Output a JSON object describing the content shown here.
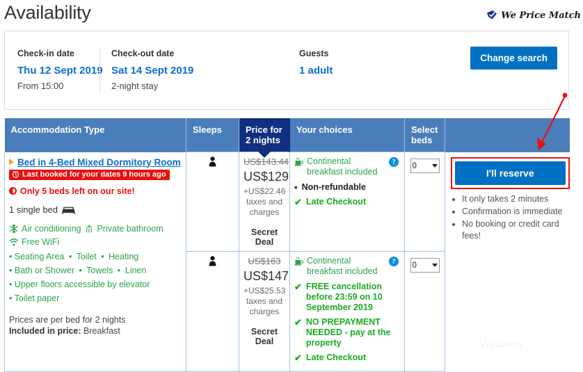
{
  "page": {
    "title": "Availability",
    "price_match": "We Price Match",
    "watermark": "Windows"
  },
  "search_summary": {
    "checkin": {
      "label": "Check-in date",
      "date": "Thu 12 Sept 2019",
      "sub": "From 15:00"
    },
    "checkout": {
      "label": "Check-out date",
      "date": "Sat 14 Sept 2019",
      "sub": "2-night stay"
    },
    "guests": {
      "label": "Guests",
      "value": "1 adult"
    },
    "change_search_label": "Change search"
  },
  "table": {
    "headers": {
      "accommodation": "Accommodation Type",
      "sleeps": "Sleeps",
      "price": "Price for 2 nights",
      "price_line1": "Price for",
      "price_line2": "2 nights",
      "choices": "Your choices",
      "select_beds_line1": "Select",
      "select_beds_line2": "beds",
      "blank": ""
    },
    "room": {
      "name": "Bed in 4-Bed Mixed Dormitory Room",
      "last_booked_badge": "Last booked for your dates 9 hours ago",
      "beds_left": "Only 5 beds left on our site!",
      "bed_config": "1 single bed",
      "amenities_icons": [
        {
          "icon": "snowflake-icon",
          "label": "Air conditioning"
        },
        {
          "icon": "shower-icon",
          "label": "Private bathroom"
        },
        {
          "icon": "wifi-icon",
          "label": "Free WiFi"
        }
      ],
      "amenities_list": [
        [
          "Seating Area",
          "Toilet",
          "Heating"
        ],
        [
          "Bath or Shower",
          "Towels",
          "Linen"
        ],
        [
          "Upper floors accessible by elevator"
        ],
        [
          "Toilet paper"
        ]
      ],
      "price_note": "Prices are per bed for 2 nights",
      "included_label": "Included in price:",
      "included_value": "Breakfast"
    },
    "offers": [
      {
        "sleeps": 1,
        "old_price": "US$143.44",
        "price": "US$129",
        "taxes": "+US$22.46 taxes and charges",
        "deal_tag": "Secret Deal",
        "breakfast": "Continental breakfast included",
        "help_icon": "?",
        "choices": [
          {
            "marker": "bullet",
            "style": "dark",
            "text": "Non-refundable"
          },
          {
            "marker": "check",
            "style": "green",
            "text": "Late Checkout"
          }
        ],
        "beds_selected": "0"
      },
      {
        "sleeps": 1,
        "old_price": "US$163",
        "price": "US$147",
        "taxes": "+US$25.53 taxes and charges",
        "deal_tag": "Secret Deal",
        "breakfast": "Continental breakfast included",
        "help_icon": "?",
        "choices": [
          {
            "marker": "check",
            "style": "green",
            "text": "FREE cancellation before 23:59 on 10 September 2019"
          },
          {
            "marker": "check",
            "style": "green",
            "text": "NO PREPAYMENT NEEDED - pay at the property"
          },
          {
            "marker": "check",
            "style": "green",
            "text": "Late Checkout"
          }
        ],
        "beds_selected": "0"
      }
    ]
  },
  "reserve": {
    "button_label": "I'll reserve",
    "bullets": [
      "It only takes 2 minutes",
      "Confirmation is immediate",
      "No booking or credit card fees!"
    ]
  },
  "colors": {
    "brand_blue": "#0071c2",
    "link_blue": "#0a6ed1",
    "header_blue": "#4a7ebb",
    "price_navy": "#10307f",
    "alert_red": "#e8110e",
    "green": "#2aa34a",
    "bright_green": "#1aaa22"
  }
}
